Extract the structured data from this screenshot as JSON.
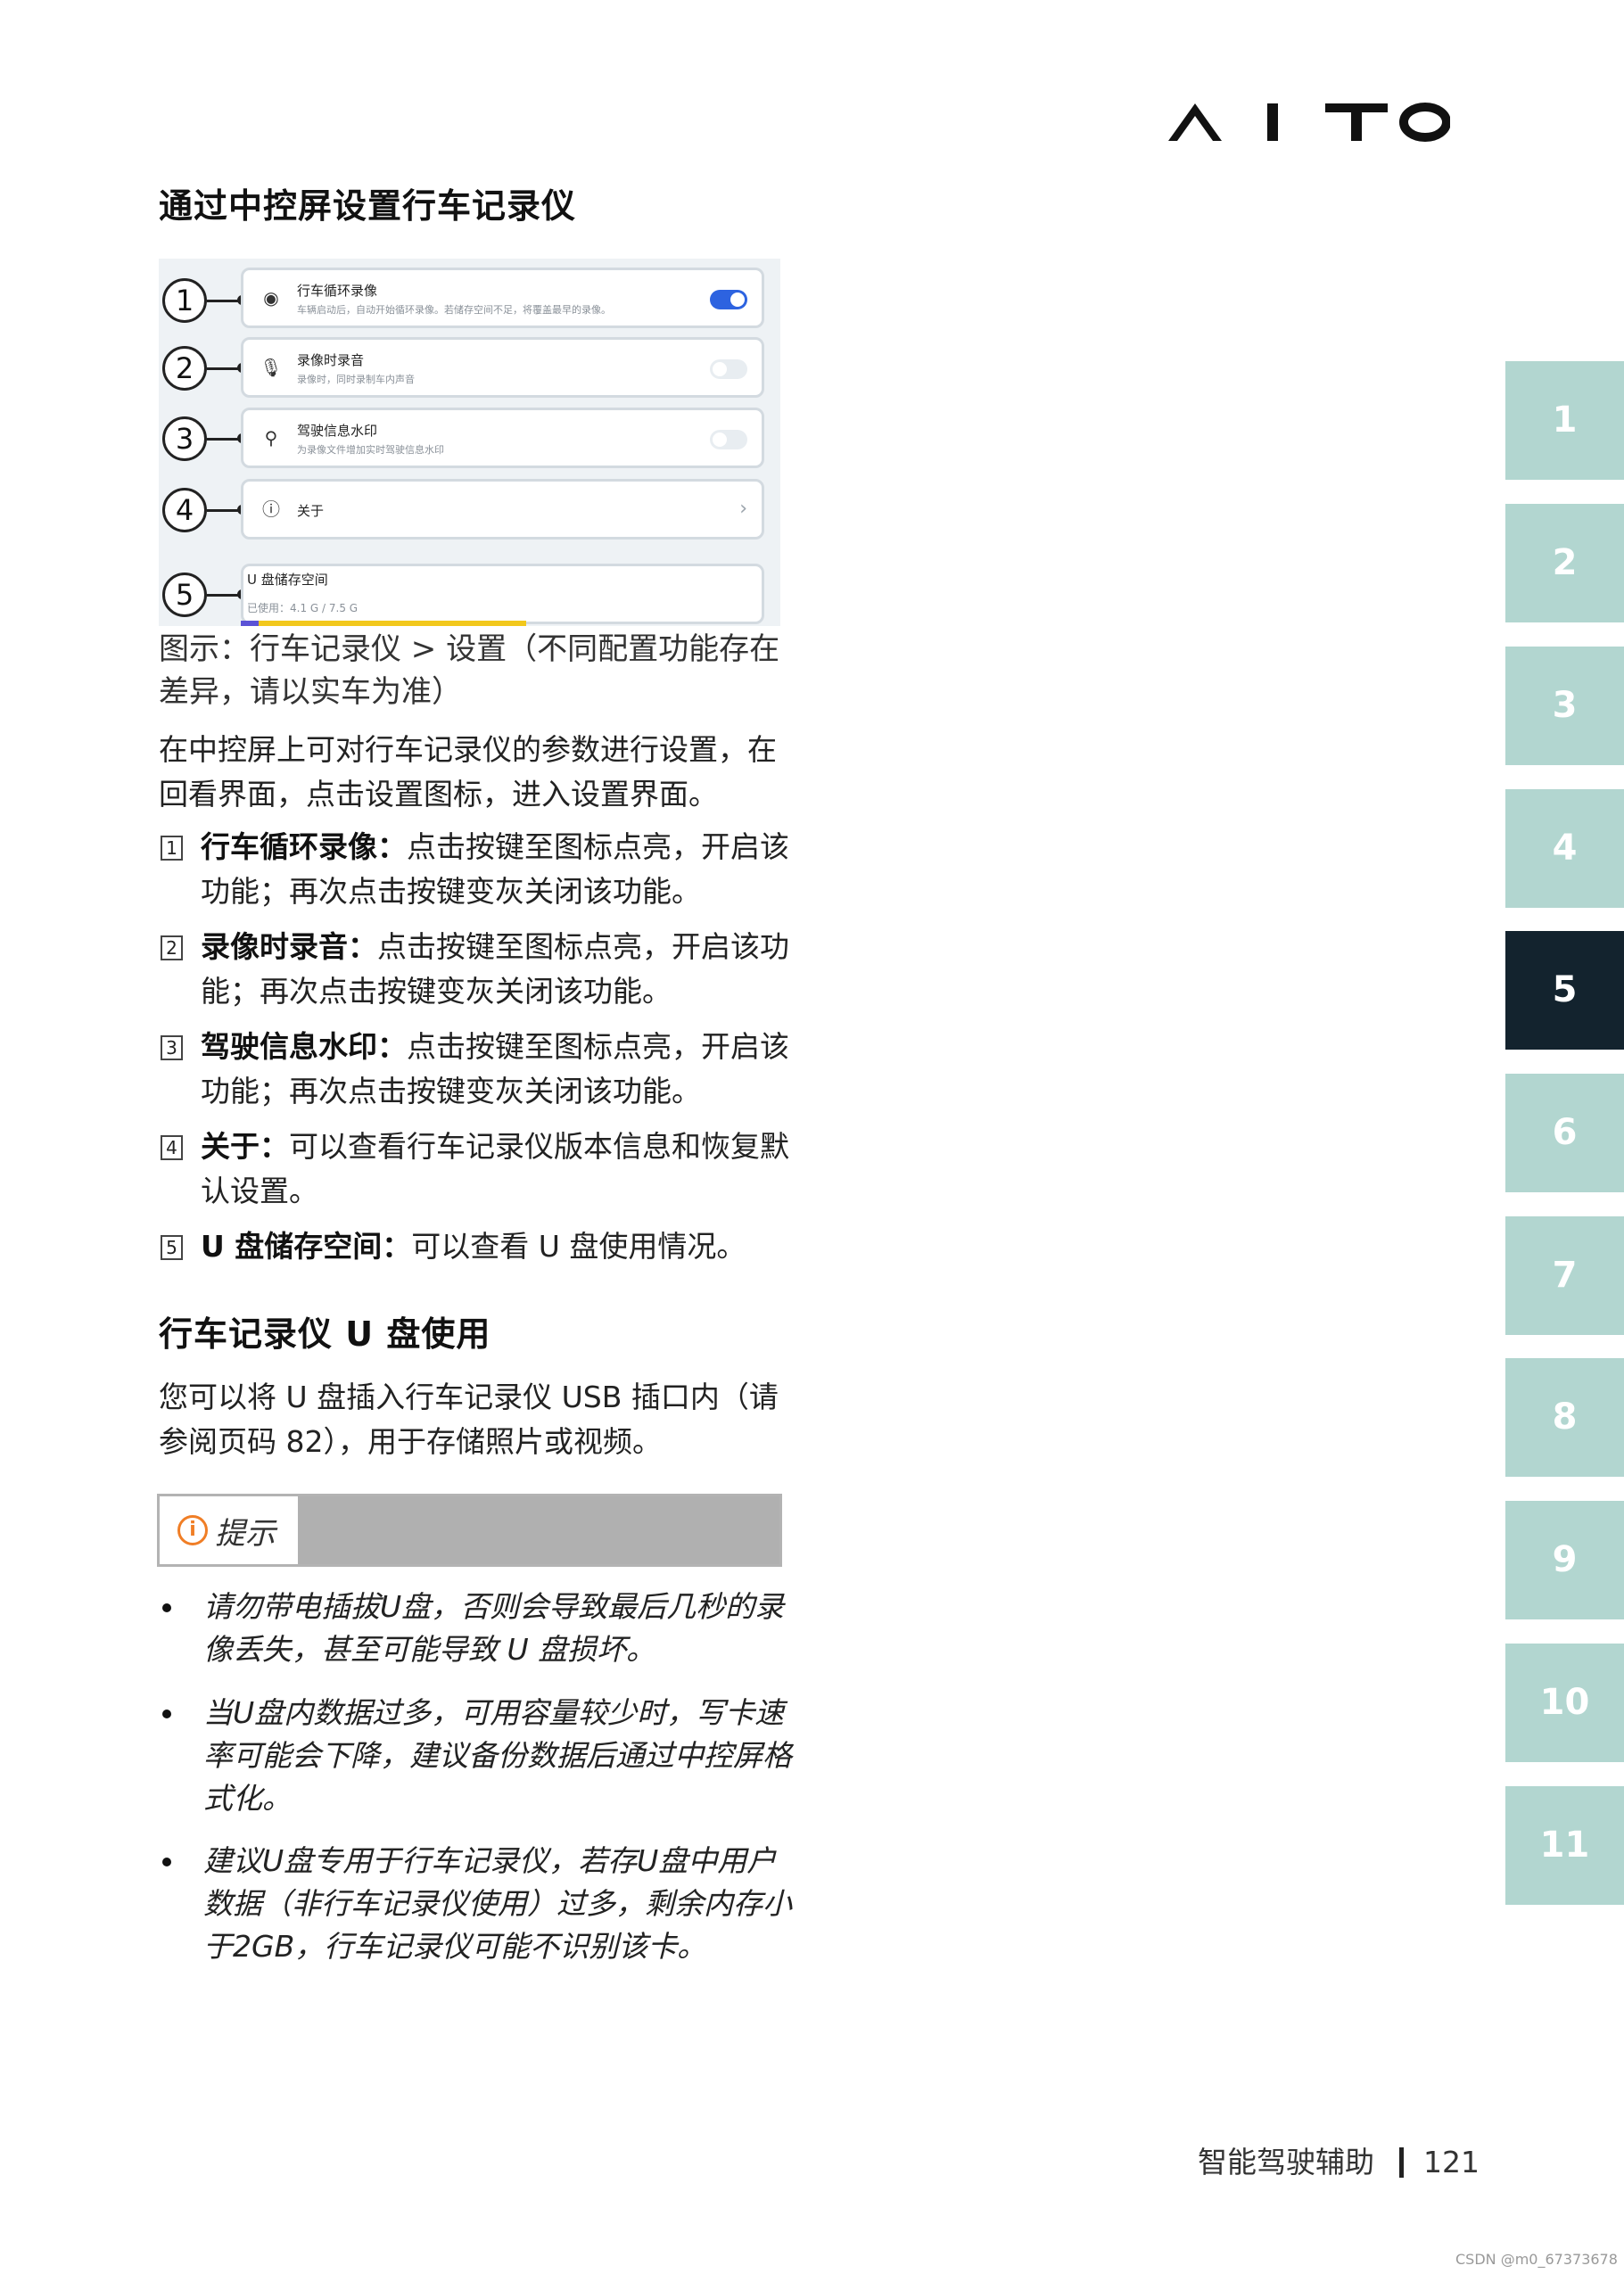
{
  "brand": {
    "logo_text": "AITO"
  },
  "section1": {
    "title": "通过中控屏设置行车记录仪"
  },
  "figure": {
    "callouts": [
      "1",
      "2",
      "3",
      "4",
      "5"
    ],
    "rows": [
      {
        "title": "行车循环录像",
        "subtitle": "车辆启动后，自动开始循环录像。若储存空间不足，将覆盖最早的录像。",
        "toggle": "on"
      },
      {
        "title": "录像时录音",
        "subtitle": "录像时，同时录制车内声音",
        "toggle": "off"
      },
      {
        "title": "驾驶信息水印",
        "subtitle": "为录像文件增加实时驾驶信息水印",
        "toggle": "off"
      },
      {
        "title": "关于"
      }
    ],
    "storage": {
      "title": "U 盘储存空间",
      "used_label": "已使用：4.1 G / 7.5 G"
    }
  },
  "caption": "图示：行车记录仪 > 设置（不同配置功能存在差异，请以实车为准）",
  "intro": "在中控屏上可对行车记录仪的参数进行设置，在回看界面，点击设置图标，进入设置界面。",
  "items": [
    {
      "num": "1",
      "label": "行车循环录像：",
      "text": "点击按键至图标点亮，开启该功能；再次点击按键变灰关闭该功能。"
    },
    {
      "num": "2",
      "label": "录像时录音：",
      "text": "点击按键至图标点亮，开启该功能；再次点击按键变灰关闭该功能。"
    },
    {
      "num": "3",
      "label": "驾驶信息水印：",
      "text": "点击按键至图标点亮，开启该功能；再次点击按键变灰关闭该功能。"
    },
    {
      "num": "4",
      "label": "关于：",
      "text": "可以查看行车记录仪版本信息和恢复默认设置。"
    },
    {
      "num": "5",
      "label": "U 盘储存空间：",
      "text": "可以查看 U 盘使用情况。"
    }
  ],
  "section2": {
    "title": "行车记录仪 U 盘使用",
    "body": "您可以将 U 盘插入行车记录仪 USB 插口内（请参阅页码 82），用于存储照片或视频。"
  },
  "note": {
    "icon_glyph": "i",
    "label": "提示",
    "bullets": [
      "请勿带电插拔U盘，否则会导致最后几秒的录像丢失，甚至可能导致 U 盘损坏。",
      "当U盘内数据过多，可用容量较少时，写卡速率可能会下降，建议备份数据后通过中控屏格式化。",
      "建议U盘专用于行车记录仪，若存U盘中用户数据（非行车记录仪使用）过多，剩余内存小于2GB，行车记录仪可能不识别该卡。"
    ]
  },
  "tabs": [
    "1",
    "2",
    "3",
    "4",
    "5",
    "6",
    "7",
    "8",
    "9",
    "10",
    "11"
  ],
  "active_tab": "5",
  "footer": {
    "section": "智能驾驶辅助",
    "page": "121"
  },
  "watermark": "CSDN @m0_67373678",
  "colors": {
    "tab": "#b2d6d0",
    "tab_active": "#13232e",
    "note_accent": "#f07e26",
    "toggle_on": "#2d63e0"
  }
}
